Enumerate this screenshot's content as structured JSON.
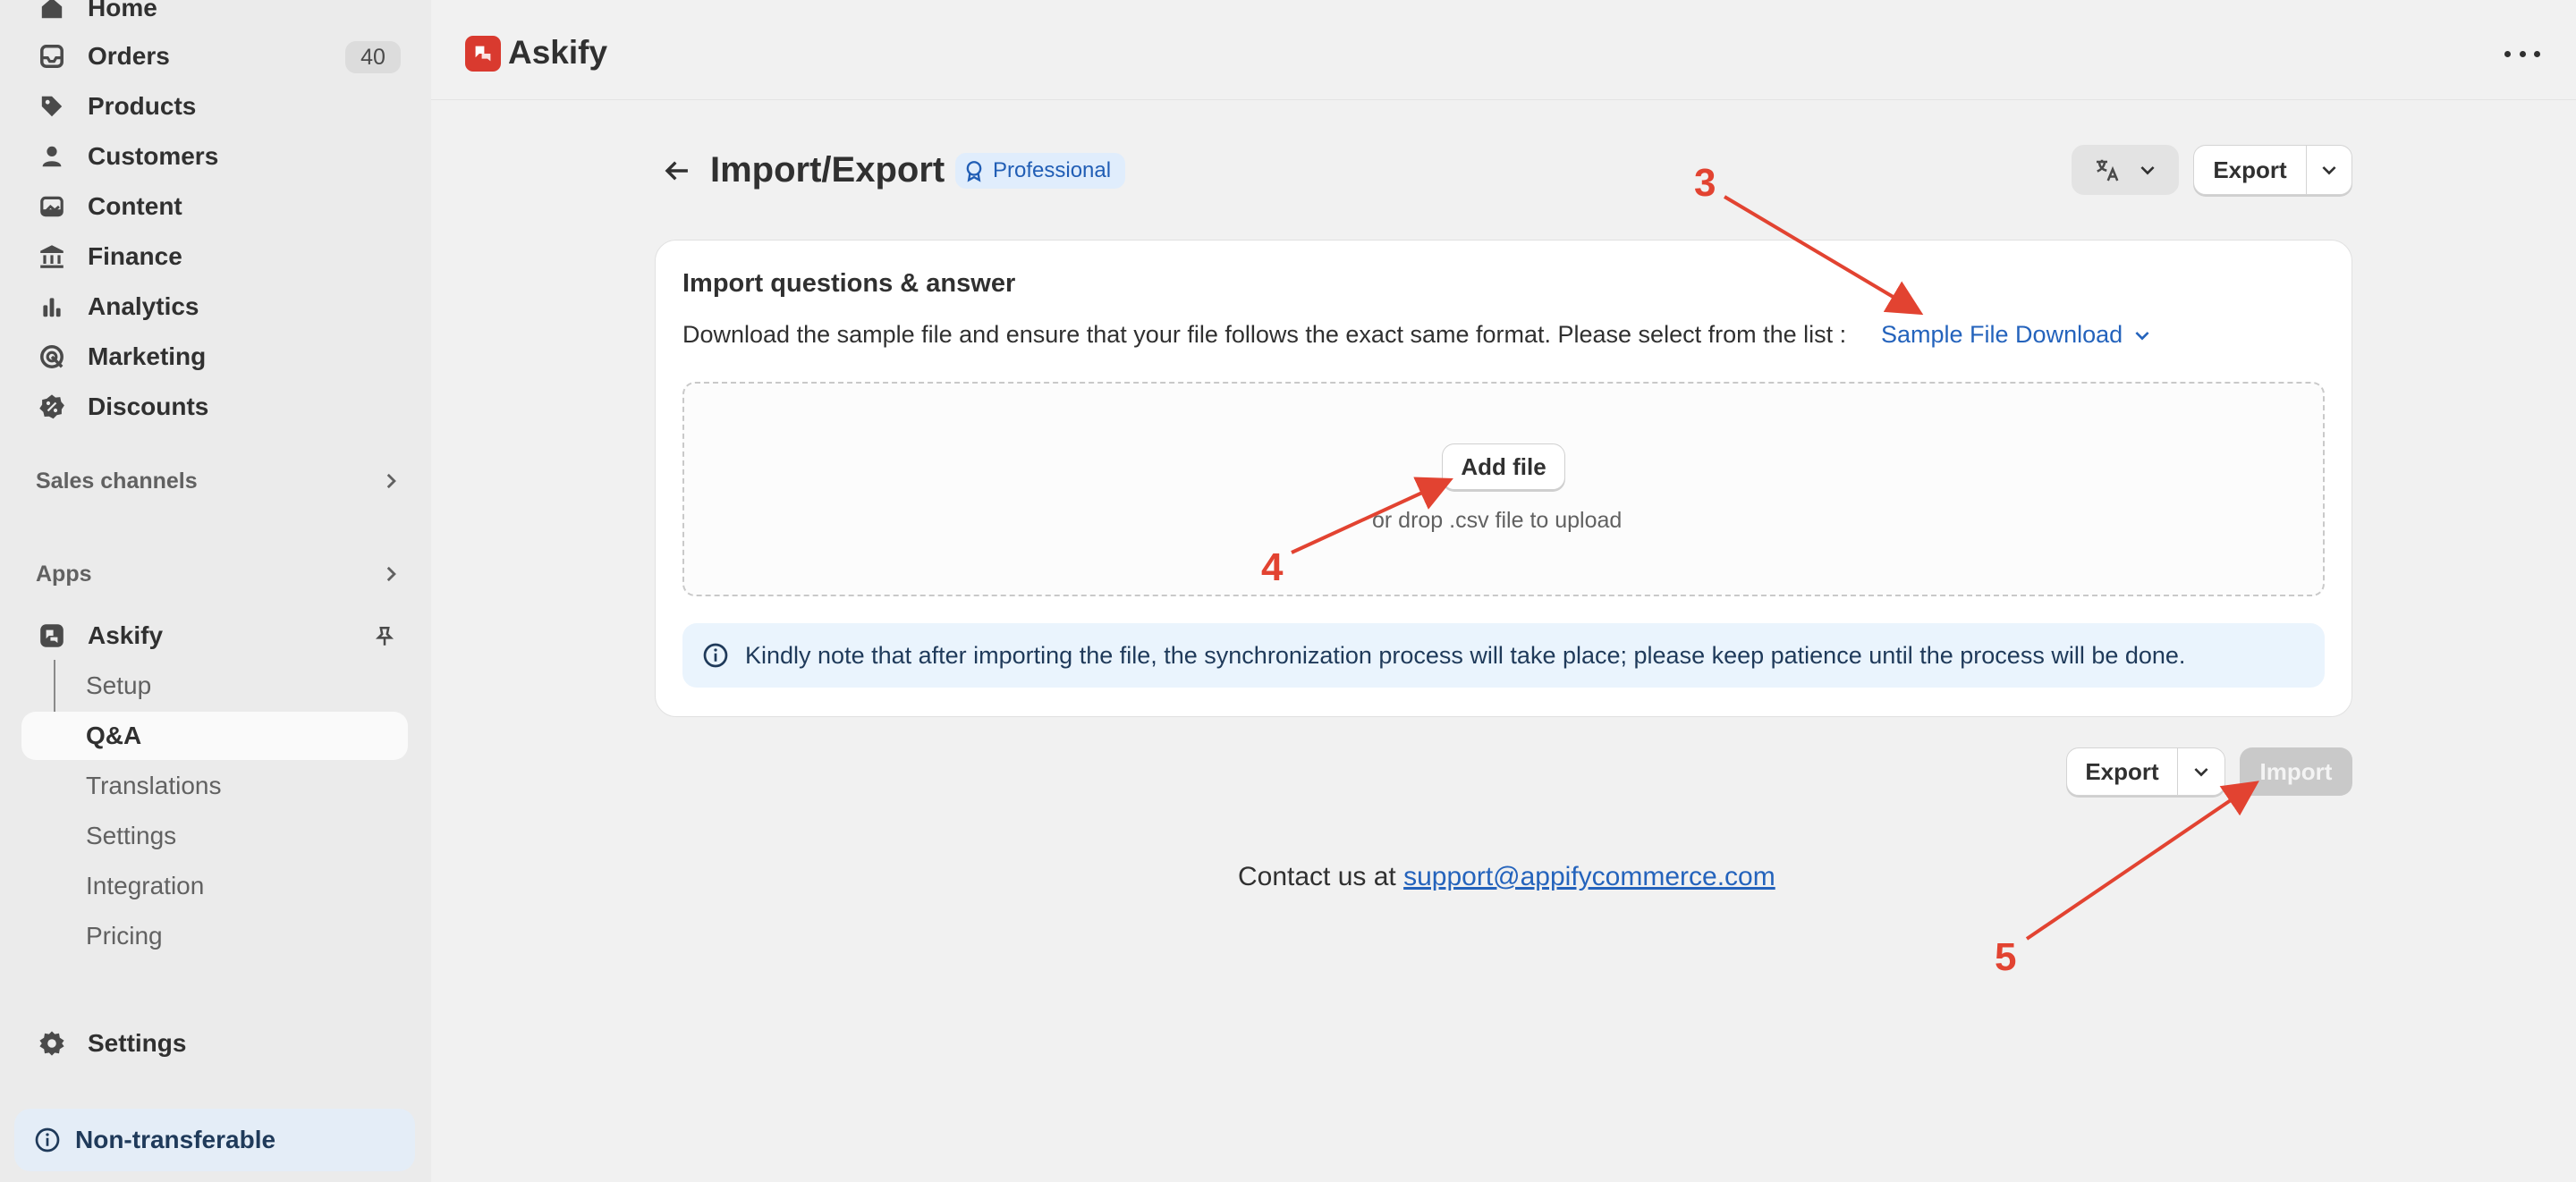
{
  "sidebar": {
    "items": [
      {
        "label": "Home",
        "icon": "home-icon"
      },
      {
        "label": "Orders",
        "icon": "inbox-icon",
        "badge": "40"
      },
      {
        "label": "Products",
        "icon": "tag-icon"
      },
      {
        "label": "Customers",
        "icon": "person-icon"
      },
      {
        "label": "Content",
        "icon": "image-icon"
      },
      {
        "label": "Finance",
        "icon": "bank-icon"
      },
      {
        "label": "Analytics",
        "icon": "bar-chart-icon"
      },
      {
        "label": "Marketing",
        "icon": "target-icon"
      },
      {
        "label": "Discounts",
        "icon": "discount-icon"
      }
    ],
    "sales_channels": "Sales channels",
    "apps": "Apps",
    "app": {
      "label": "Askify",
      "sub_items": [
        "Setup",
        "Q&A",
        "Translations",
        "Settings",
        "Integration",
        "Pricing"
      ],
      "active": "Q&A"
    },
    "settings": "Settings",
    "non_transferable": "Non-transferable"
  },
  "topbar": {
    "app_name": "Askify"
  },
  "page": {
    "title": "Import/Export",
    "plan_badge": "Professional",
    "export_label": "Export"
  },
  "card": {
    "title": "Import questions & answer",
    "description": "Download the sample file and ensure that your file follows the exact same format. Please select from the list :",
    "sample_link": "Sample File Download",
    "add_file": "Add file",
    "drop_hint": "or drop .csv file to upload",
    "notice": "Kindly note that after importing the file, the synchronization process will take place; please keep patience until the process will be done."
  },
  "footer_actions": {
    "export_label": "Export",
    "import_label": "Import"
  },
  "contact": {
    "prefix": "Contact us at",
    "email": "support@appifycommerce.com"
  },
  "annotations": [
    "3",
    "4",
    "5"
  ],
  "colors": {
    "accent_link": "#2463bc",
    "annotation": "#e24331",
    "app_logo": "#d93a2f"
  }
}
